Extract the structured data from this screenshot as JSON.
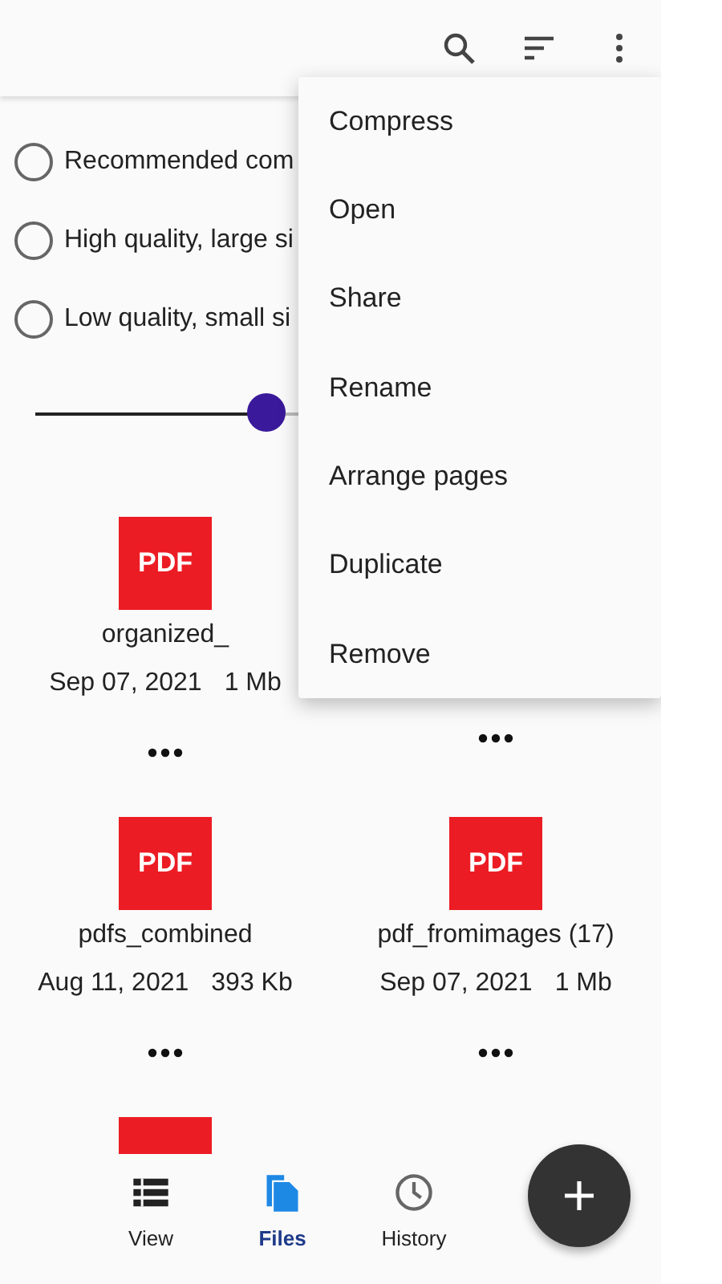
{
  "options": [
    {
      "label": "Recommended com",
      "selected": false
    },
    {
      "label": "High quality, large si",
      "selected": false
    },
    {
      "label": "Low quality, small si",
      "selected": false
    }
  ],
  "slider": {
    "level": 0.39
  },
  "files": [
    {
      "kind": "file",
      "badge": "PDF",
      "name": "organized_",
      "date": "Sep 07, 2021",
      "size": "1 Mb"
    },
    {
      "kind": "covered"
    },
    {
      "kind": "file",
      "badge": "PDF",
      "name": "pdfs_combined",
      "date": "Aug 11, 2021",
      "size": "393 Kb"
    },
    {
      "kind": "file",
      "badge": "PDF",
      "name": "pdf_fromimages (17)",
      "date": "Sep 07, 2021",
      "size": "1 Mb"
    },
    {
      "kind": "cut"
    }
  ],
  "menu": [
    "Compress",
    "Open",
    "Share",
    "Rename",
    "Arrange pages",
    "Duplicate",
    "Remove"
  ],
  "nav": [
    {
      "label": "View",
      "selected": false
    },
    {
      "label": "Files",
      "selected": true
    },
    {
      "label": "History",
      "selected": false
    }
  ]
}
